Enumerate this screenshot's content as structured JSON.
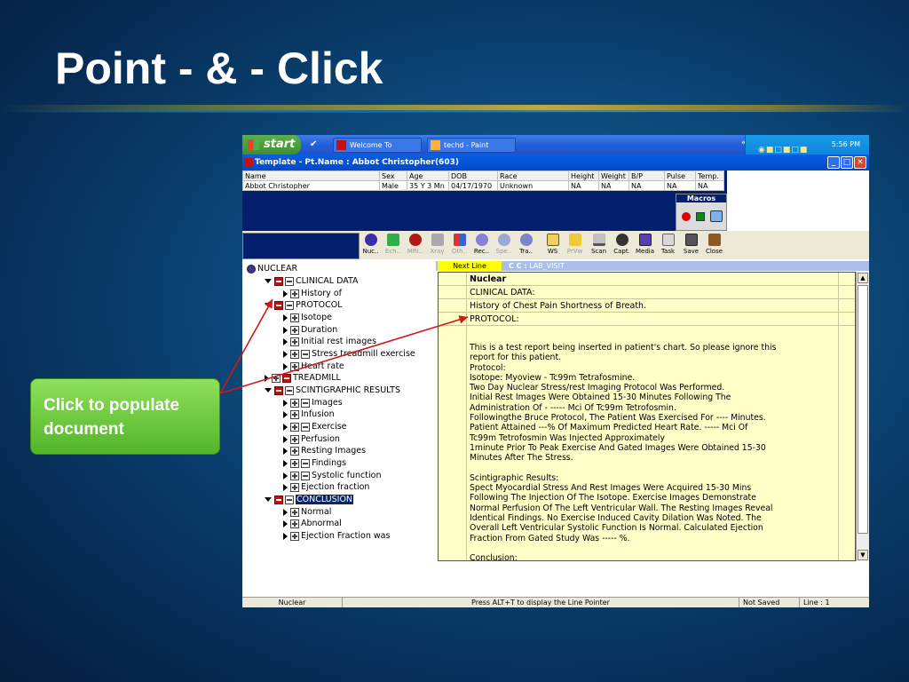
{
  "slide": {
    "title": "Point - & - Click",
    "callout": "Click to populate document"
  },
  "taskbar": {
    "start_label": "start",
    "tasks": [
      "Welcome To LoginClin...",
      "techd - Paint"
    ],
    "clock": "5:56 PM"
  },
  "window": {
    "title": "Template - Pt.Name : Abbot Christopher(603)"
  },
  "patient": {
    "headers": [
      "Name",
      "Sex",
      "Age",
      "DOB",
      "Race",
      "Height",
      "Weight",
      "B/P",
      "Pulse",
      "Temp."
    ],
    "values": [
      "Abbot Christopher",
      "Male",
      "35 Y 3 Mn",
      "04/17/1970",
      "Unknown",
      "NA",
      "NA",
      "NA",
      "NA",
      "NA"
    ]
  },
  "macros": {
    "label": "Macros"
  },
  "toolbar": {
    "buttons": [
      "Nuc..",
      "Ech..",
      "MRI..",
      "Xray",
      "Oth..",
      "Rec..",
      "Spe..",
      "Tra..",
      "WS",
      "PrVw",
      "Scan",
      "Capt.",
      "Media",
      "Task",
      "Save",
      "Close"
    ]
  },
  "tree": {
    "root": "NUCLEAR",
    "nodes": [
      "CLINICAL DATA",
      "History of",
      "PROTOCOL",
      "Isotope",
      "Duration",
      "Initial rest images",
      "Stress treadmill exercise",
      "Heart rate",
      "TREADMILL",
      "SCINTIGRAPHIC RESULTS",
      "Images",
      "Infusion",
      "Exercise",
      "Perfusion",
      "Resting Images",
      "Findings",
      "Systolic function",
      "Ejection fraction",
      "CONCLUSION",
      "Normal",
      "Abnormal",
      "Ejection Fraction was"
    ]
  },
  "doc": {
    "next_line": "Next Line",
    "cc_label": "C C :",
    "cc_value": "LAB_VISIT",
    "rows": [
      "Nuclear",
      "CLINICAL DATA:",
      "History of Chest Pain Shortness of Breath.",
      "PROTOCOL:"
    ],
    "body": "This is a test report being inserted in patient's chart. So please ignore this\nreport for this patient.\nProtocol:\nIsotope: Myoview - Tc99m Tetrafosmine.\nTwo Day Nuclear Stress/rest Imaging Protocol Was Performed.\nInitial Rest Images Were Obtained 15-30 Minutes Following The\nAdministration Of - ----- Mci Of Tc99m Tetrofosmin.\nFollowingthe Bruce Protocol, The Patient Was Exercised For ---- Minutes.\nPatient Attained ---% Of Maximum Predicted Heart Rate. ----- Mci Of\nTc99m Tetrofosmin Was Injected Approximately\n1minute Prior To Peak Exercise And Gated Images Were Obtained 15-30\nMinutes After The Stress.\n\nScintigraphic Results:\nSpect Myocardial Stress And Rest Images Were Acquired 15-30 Mins\nFollowing The Injection Of The Isotope. Exercise Images Demonstrate\nNormal Perfusion Of The Left Ventricular Wall. The Resting Images Reveal\nIdentical Findings. No Exercise Induced Cavity Dilation Was Noted. The\nOverall Left Ventricular Systolic Function Is Normal. Calculated Ejection\nFraction From Gated Study Was ----- %.\n\nConclusion:"
  },
  "status": {
    "left": "Nuclear",
    "center": "Press ALT+T to display the Line Pointer",
    "saved": "Not Saved",
    "line": "Line : 1"
  },
  "colors": {
    "accent_green": "#52b52a",
    "arrow_red": "#d01818",
    "doc_yellow": "#ffffc8",
    "title_blue": "#0249c9"
  }
}
